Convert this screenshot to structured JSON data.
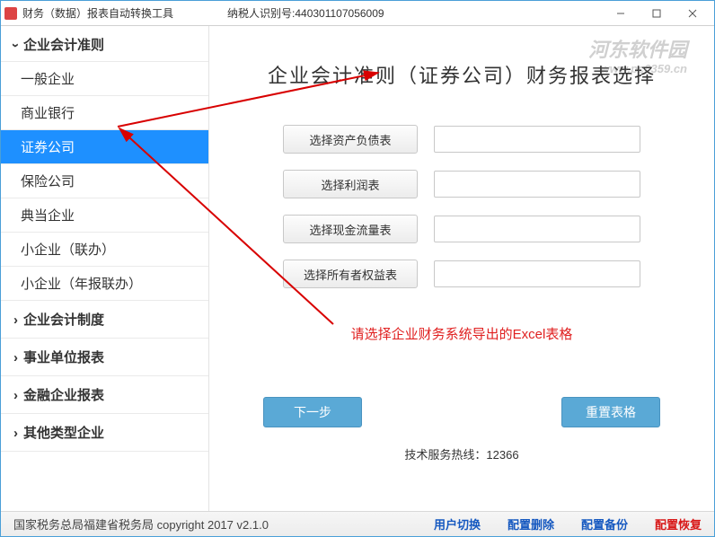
{
  "window": {
    "title": "财务（数据）报表自动转换工具",
    "tax_label": "纳税人识别号:440301107056009"
  },
  "watermark": {
    "line1": "河东软件园",
    "line2": "www.pc0359.cn"
  },
  "sidebar": {
    "sections": [
      {
        "label": "企业会计准则",
        "expanded": true
      },
      {
        "label": "企业会计制度",
        "expanded": false
      },
      {
        "label": "事业单位报表",
        "expanded": false
      },
      {
        "label": "金融企业报表",
        "expanded": false
      },
      {
        "label": "其他类型企业",
        "expanded": false
      }
    ],
    "items": [
      {
        "label": "一般企业"
      },
      {
        "label": "商业银行"
      },
      {
        "label": "证券公司",
        "selected": true
      },
      {
        "label": "保险公司"
      },
      {
        "label": "典当企业"
      },
      {
        "label": "小企业（联办）"
      },
      {
        "label": "小企业（年报联办）"
      }
    ]
  },
  "content": {
    "title": "企业会计准则（证券公司）财务报表选择",
    "rows": [
      {
        "btn": "选择资产负债表",
        "value": ""
      },
      {
        "btn": "选择利润表",
        "value": ""
      },
      {
        "btn": "选择现金流量表",
        "value": ""
      },
      {
        "btn": "选择所有者权益表",
        "value": ""
      }
    ],
    "hint": "请选择企业财务系统导出的Excel表格",
    "next_btn": "下一步",
    "reset_btn": "重置表格",
    "hotline": "技术服务热线：12366"
  },
  "footer": {
    "copyright": "国家税务总局福建省税务局  copyright 2017  v2.1.0",
    "links": [
      {
        "label": "用户切换",
        "danger": false
      },
      {
        "label": "配置删除",
        "danger": false
      },
      {
        "label": "配置备份",
        "danger": false
      },
      {
        "label": "配置恢复",
        "danger": true
      }
    ]
  }
}
